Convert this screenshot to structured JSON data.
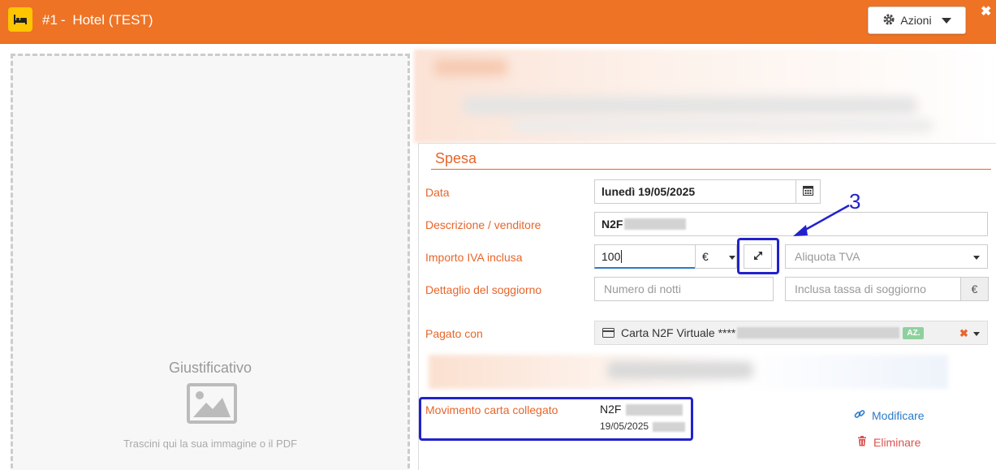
{
  "header": {
    "number": "#1",
    "separator": "-",
    "title": "Hotel (TEST)",
    "actions_label": "Azioni"
  },
  "dropzone": {
    "title": "Giustificativo",
    "hint": "Trascini qui la sua immagine o il PDF"
  },
  "section": {
    "title": "Spesa"
  },
  "form": {
    "date_label": "Data",
    "date_value": "lunedì 19/05/2025",
    "description_label": "Descrizione / venditore",
    "description_value": "N2F",
    "amount_label": "Importo IVA inclusa",
    "amount_value": "100",
    "currency": "€",
    "vat_placeholder": "Aliquota TVA",
    "stay_label": "Dettaglio del soggiorno",
    "nights_placeholder": "Numero di notti",
    "tax_placeholder": "Inclusa tassa di soggiorno",
    "tax_currency": "€",
    "paid_label": "Pagato con",
    "card_value": "Carta N2F Virtuale ****",
    "card_badge": "AZ.",
    "linked_label": "Movimento carta collegato",
    "linked_name": "N2F",
    "linked_date": "19/05/2025",
    "edit_label": "Modificare",
    "delete_label": "Eliminare"
  },
  "annotation": {
    "number": "3",
    "color": "#2222cc"
  },
  "colors": {
    "brand": "#ee7325",
    "label": "#e8652a",
    "link": "#2a7bc8",
    "danger": "#d9534f"
  }
}
